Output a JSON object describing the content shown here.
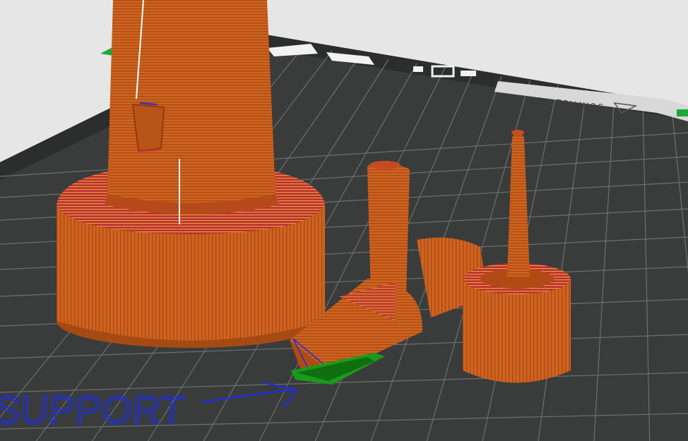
{
  "viewport": {
    "background": "#e6e6e6",
    "bed_color": "#3a3c3c",
    "grid_color": "#6d7070",
    "bed_label": "SURFACE  HOT",
    "bed_icon": "triangle-logo-icon"
  },
  "models": [
    {
      "name": "tall-cone-nozzle",
      "color": "#d0651f"
    },
    {
      "name": "angled-adapter",
      "color": "#d0651f"
    },
    {
      "name": "small-spike-cap",
      "color": "#d0651f"
    }
  ],
  "support_color": "#1a9a1a",
  "annotation": {
    "text": "SUPPORT",
    "color": "#1f2fd8"
  }
}
